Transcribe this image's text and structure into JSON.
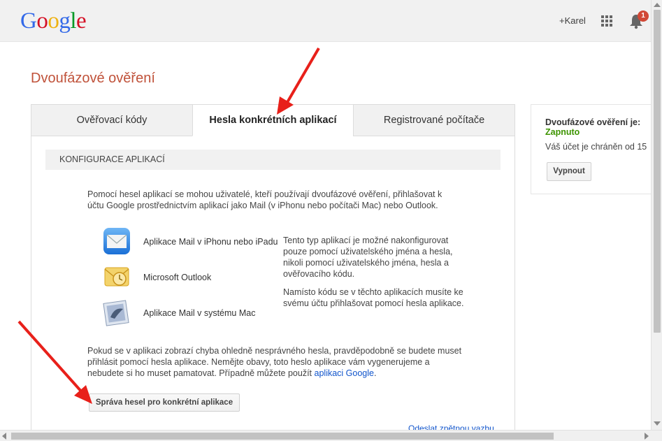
{
  "header": {
    "logo_letters": [
      {
        "ch": "G",
        "color": "#3369e8"
      },
      {
        "ch": "o",
        "color": "#d50f25"
      },
      {
        "ch": "o",
        "color": "#eeb211"
      },
      {
        "ch": "g",
        "color": "#3369e8"
      },
      {
        "ch": "l",
        "color": "#009925"
      },
      {
        "ch": "e",
        "color": "#d50f25"
      }
    ],
    "user_link": "+Karel",
    "notification_count": "1"
  },
  "page": {
    "title": "Dvoufázové ověření"
  },
  "tabs": [
    {
      "label": "Ověřovací kódy",
      "active": false
    },
    {
      "label": "Hesla konkrétních aplikací",
      "active": true
    },
    {
      "label": "Registrované počítače",
      "active": false
    }
  ],
  "section": {
    "heading": "KONFIGURACE APLIKACÍ",
    "intro": "Pomocí hesel aplikací se mohou uživatelé, kteří používají dvoufázové ověření, přihlašovat k účtu Google prostřednictvím aplikací jako Mail (v iPhonu nebo počítači Mac) nebo Outlook.",
    "apps": [
      {
        "label": "Aplikace Mail v iPhonu nebo iPadu",
        "icon": "iphone-mail-icon"
      },
      {
        "label": "Microsoft Outlook",
        "icon": "outlook-icon"
      },
      {
        "label": "Aplikace Mail v systému Mac",
        "icon": "mac-mail-icon"
      }
    ],
    "note_1": "Tento typ aplikací je možné nakonfigurovat pouze pomocí uživatelského jména a hesla, nikoli pomocí uživatelského jména, hesla a ověřovacího kódu.",
    "note_2": "Namísto kódu se v těchto aplikacích musíte ke svému účtu přihlašovat pomocí hesla aplikace.",
    "outro": "Pokud se v aplikaci zobrazí chyba ohledně nesprávného hesla, pravděpodobně se budete muset přihlásit pomocí hesla aplikace. Nemějte obavy, toto heslo aplikace vám vygenerujeme a nebudete si ho muset pamatovat. Případně můžete použít ",
    "outro_link": "aplikaci Google",
    "outro_end": ".",
    "manage_button": "Správa hesel pro konkrétní aplikace",
    "feedback_link": "Odeslat zpětnou vazbu"
  },
  "status": {
    "title": "Dvoufázové ověření je:",
    "value": "Zapnuto",
    "description": "Váš účet je chráněn od 15",
    "disable_button": "Vypnout"
  },
  "colors": {
    "title_red": "#c0523a",
    "status_green": "#3d9400",
    "link_blue": "#1155cc",
    "arrow_red": "#e8201a"
  }
}
